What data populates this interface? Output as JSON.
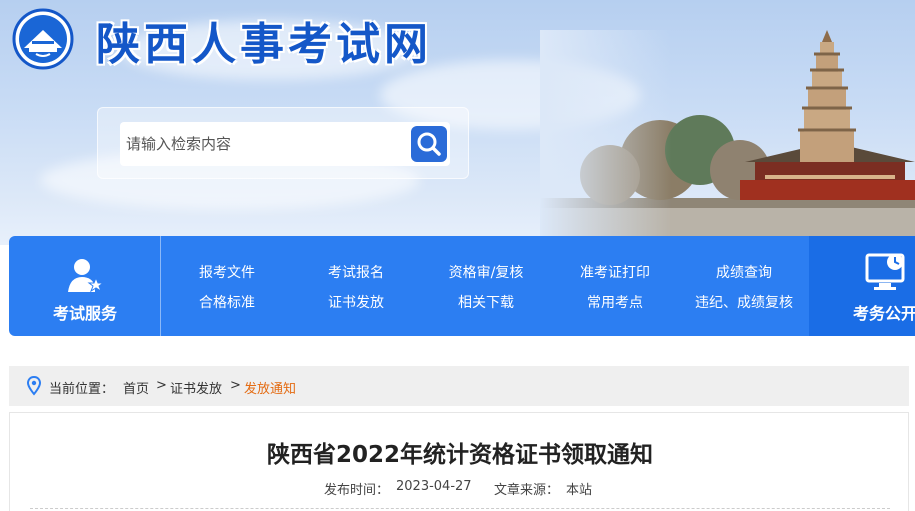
{
  "header": {
    "site_title": "陕西人事考试网",
    "search": {
      "placeholder": "请输入检索内容"
    }
  },
  "nav": {
    "left_label": "考试服务",
    "right_label": "考务公开",
    "row1": [
      "报考文件",
      "考试报名",
      "资格审/复核",
      "准考证打印",
      "成绩查询"
    ],
    "row2": [
      "合格标准",
      "证书发放",
      "相关下载",
      "常用考点",
      "违纪、成绩复核"
    ]
  },
  "breadcrumb": {
    "prefix": "当前位置：",
    "items": [
      "首页",
      "证书发放",
      "发放通知"
    ],
    "separator": ">"
  },
  "article": {
    "title": "陕西省2022年统计资格证书领取通知",
    "publish_label": "发布时间：",
    "publish_date": "2023-04-27",
    "source_label": "文章来源：",
    "source": "本站"
  },
  "colors": {
    "brand_blue": "#2c7ef2",
    "title_blue": "#1457c8",
    "breadcrumb_active": "#e46b12"
  }
}
